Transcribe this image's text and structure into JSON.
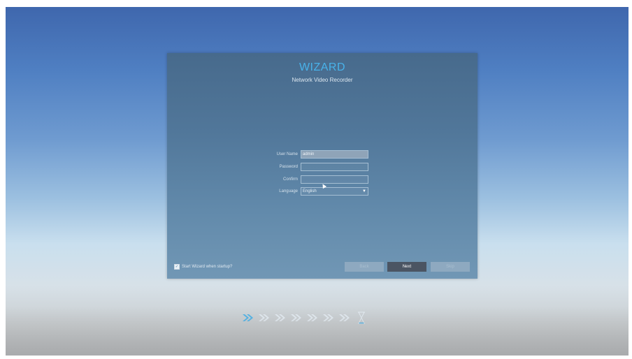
{
  "wizard": {
    "title": "WIZARD",
    "subtitle": "Network Video Recorder"
  },
  "form": {
    "username_label": "User Name",
    "username_value": "admin",
    "password_label": "Password",
    "password_value": "",
    "confirm_label": "Confirm",
    "confirm_value": "",
    "language_label": "Language",
    "language_value": "English"
  },
  "startup_option": {
    "label": "Start Wizard when startup?",
    "checked": true
  },
  "buttons": {
    "back": "Back",
    "next": "Next",
    "skip": "Skip"
  },
  "progress": {
    "total_steps": 8,
    "current_step": 1
  },
  "colors": {
    "accent": "#48b2ea",
    "active_step": "#4ab3ea",
    "inactive_step": "#e6eef5"
  }
}
